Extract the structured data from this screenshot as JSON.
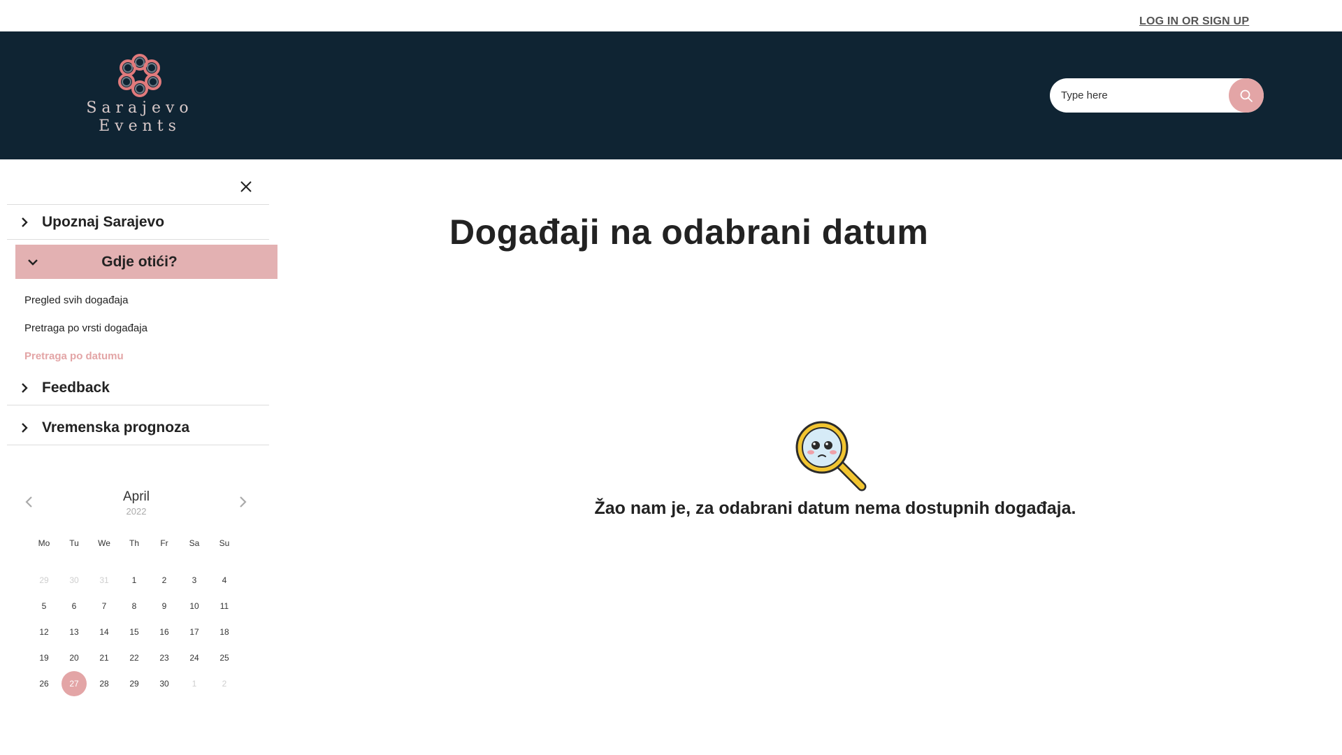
{
  "topbar": {
    "login_label": "LOG IN OR SIGN UP"
  },
  "logo": {
    "line1": "Sarajevo",
    "line2": "Events"
  },
  "search": {
    "placeholder": "Type here"
  },
  "sidebar": {
    "items": [
      {
        "label": "Upoznaj Sarajevo"
      },
      {
        "label": "Gdje otići?"
      },
      {
        "label": "Feedback"
      },
      {
        "label": "Vremenska prognoza"
      }
    ],
    "subitems": [
      {
        "label": "Pregled svih događaja"
      },
      {
        "label": "Pretraga po vrsti događaja"
      },
      {
        "label": "Pretraga po datumu"
      }
    ]
  },
  "calendar": {
    "month": "April",
    "year": "2022",
    "weekdays": [
      "Mo",
      "Tu",
      "We",
      "Th",
      "Fr",
      "Sa",
      "Su"
    ],
    "weeks": [
      [
        "29",
        "30",
        "31",
        "1",
        "2",
        "3",
        "4"
      ],
      [
        "5",
        "6",
        "7",
        "8",
        "9",
        "10",
        "11"
      ],
      [
        "12",
        "13",
        "14",
        "15",
        "16",
        "17",
        "18"
      ],
      [
        "19",
        "20",
        "21",
        "22",
        "23",
        "24",
        "25"
      ],
      [
        "26",
        "27",
        "28",
        "29",
        "30",
        "1",
        "2"
      ]
    ],
    "selected": "27"
  },
  "main": {
    "title": "Događaji na odabrani datum",
    "empty_message": "Žao nam je, za odabrani datum nema dostupnih događaja."
  },
  "colors": {
    "header_bg": "#0f2433",
    "accent": "#e3a5a6",
    "active_bg": "#e3b1b2"
  }
}
